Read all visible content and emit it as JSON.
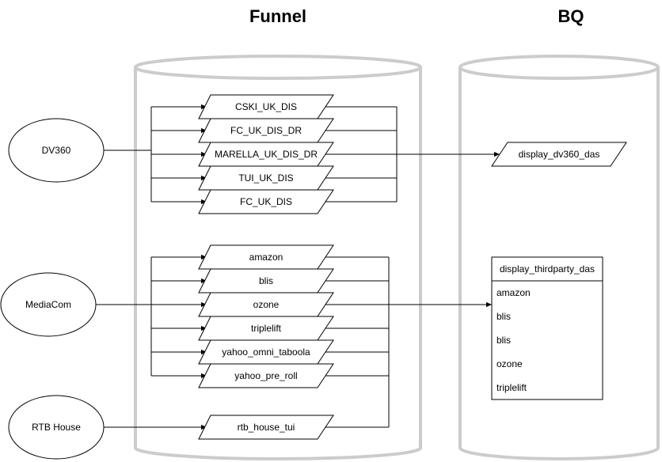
{
  "titles": {
    "funnel": "Funnel",
    "bq": "BQ"
  },
  "sources": {
    "dv360": "DV360",
    "mediacom": "MediaCom",
    "rtb": "RTB House"
  },
  "dv360_tables": [
    "CSKI_UK_DIS",
    "FC_UK_DIS_DR",
    "MARELLA_UK_DIS_DR",
    "TUI_UK_DIS",
    "FC_UK_DIS"
  ],
  "mediacom_tables": [
    "amazon",
    "blis",
    "ozone",
    "triplelift",
    "yahoo_omni_taboola",
    "yahoo_pre_roll"
  ],
  "rtb_table": "rtb_house_tui",
  "bq": {
    "dv360_target": "display_dv360_das",
    "thirdparty": {
      "header": "display_thirdparty_das",
      "rows": [
        "amazon",
        "blis",
        "blis",
        "ozone",
        "triplelift"
      ]
    }
  }
}
